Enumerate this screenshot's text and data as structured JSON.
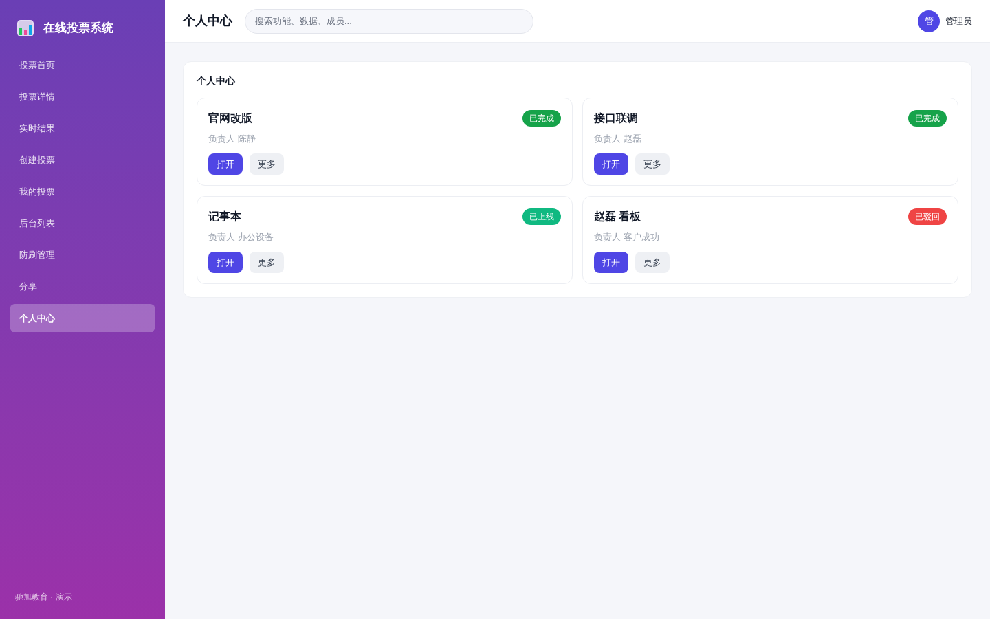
{
  "sidebar": {
    "brand": "在线投票系统",
    "items": [
      {
        "label": "投票首页",
        "selected": false
      },
      {
        "label": "投票详情",
        "selected": false
      },
      {
        "label": "实时结果",
        "selected": false
      },
      {
        "label": "创建投票",
        "selected": false
      },
      {
        "label": "我的投票",
        "selected": false
      },
      {
        "label": "后台列表",
        "selected": false
      },
      {
        "label": "防刷管理",
        "selected": false
      },
      {
        "label": "分享",
        "selected": false
      },
      {
        "label": "个人中心",
        "selected": true
      }
    ],
    "footer": "驰旭教育 · 演示"
  },
  "header": {
    "title": "个人中心",
    "search": {
      "placeholder": "搜索功能、数据、成员..."
    },
    "user": {
      "avatar": "管",
      "name": "管理员"
    }
  },
  "panel": {
    "title": "个人中心",
    "cards": [
      {
        "title": "官网改版",
        "status": {
          "label": "已完成",
          "color": "#16a34a"
        },
        "owner": "负责人 陈静",
        "actions": [
          "打开",
          "更多"
        ]
      },
      {
        "title": "接口联调",
        "status": {
          "label": "已完成",
          "color": "#16a34a"
        },
        "owner": "负责人 赵磊",
        "actions": [
          "打开",
          "更多"
        ]
      },
      {
        "title": "记事本",
        "status": {
          "label": "已上线",
          "color": "#10b981"
        },
        "owner": "负责人 办公设备",
        "actions": [
          "打开",
          "更多"
        ]
      },
      {
        "title": "赵磊 看板",
        "status": {
          "label": "已驳回",
          "color": "#ef4444"
        },
        "owner": "负责人 客户成功",
        "actions": [
          "打开",
          "更多"
        ]
      }
    ]
  }
}
